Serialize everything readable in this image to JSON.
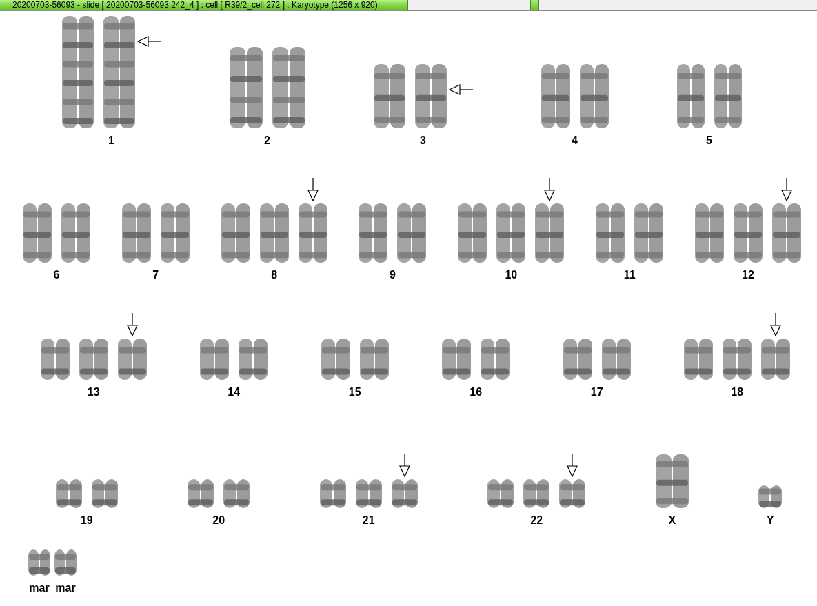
{
  "window": {
    "title": "20200703-56093 - slide [ 20200703-56093 242_4 ] : cell [ R39/2_cell 272 ] : Karyotype  (1256 x 920)"
  },
  "rows": [
    {
      "groups": [
        {
          "label": "1",
          "chromosomes": [
            {
              "marked": false
            },
            {
              "marked": true
            }
          ]
        },
        {
          "label": "2",
          "chromosomes": [
            {
              "marked": false
            },
            {
              "marked": false
            }
          ]
        },
        {
          "label": "3",
          "chromosomes": [
            {
              "marked": false
            },
            {
              "marked": true
            }
          ]
        },
        {
          "label": "4",
          "chromosomes": [
            {
              "marked": false
            },
            {
              "marked": false
            }
          ]
        },
        {
          "label": "5",
          "chromosomes": [
            {
              "marked": false
            },
            {
              "marked": false
            }
          ]
        }
      ]
    },
    {
      "groups": [
        {
          "label": "6",
          "chromosomes": [
            {
              "marked": false
            },
            {
              "marked": false
            }
          ]
        },
        {
          "label": "7",
          "chromosomes": [
            {
              "marked": false
            },
            {
              "marked": false
            }
          ]
        },
        {
          "label": "8",
          "chromosomes": [
            {
              "marked": false
            },
            {
              "marked": false
            },
            {
              "marked": true
            }
          ]
        },
        {
          "label": "9",
          "chromosomes": [
            {
              "marked": false
            },
            {
              "marked": false
            }
          ]
        },
        {
          "label": "10",
          "chromosomes": [
            {
              "marked": false
            },
            {
              "marked": false
            },
            {
              "marked": true
            }
          ]
        },
        {
          "label": "11",
          "chromosomes": [
            {
              "marked": false
            },
            {
              "marked": false
            }
          ]
        },
        {
          "label": "12",
          "chromosomes": [
            {
              "marked": false
            },
            {
              "marked": false
            },
            {
              "marked": true
            }
          ]
        }
      ]
    },
    {
      "groups": [
        {
          "label": "13",
          "chromosomes": [
            {
              "marked": false
            },
            {
              "marked": false
            },
            {
              "marked": true
            }
          ]
        },
        {
          "label": "14",
          "chromosomes": [
            {
              "marked": false
            },
            {
              "marked": false
            }
          ]
        },
        {
          "label": "15",
          "chromosomes": [
            {
              "marked": false
            },
            {
              "marked": false
            }
          ]
        },
        {
          "label": "16",
          "chromosomes": [
            {
              "marked": false
            },
            {
              "marked": false
            }
          ]
        },
        {
          "label": "17",
          "chromosomes": [
            {
              "marked": false
            },
            {
              "marked": false
            }
          ]
        },
        {
          "label": "18",
          "chromosomes": [
            {
              "marked": false
            },
            {
              "marked": false
            },
            {
              "marked": true
            }
          ]
        }
      ]
    },
    {
      "groups": [
        {
          "label": "19",
          "chromosomes": [
            {
              "marked": false
            },
            {
              "marked": false
            }
          ]
        },
        {
          "label": "20",
          "chromosomes": [
            {
              "marked": false
            },
            {
              "marked": false
            }
          ]
        },
        {
          "label": "21",
          "chromosomes": [
            {
              "marked": false
            },
            {
              "marked": false
            },
            {
              "marked": true
            }
          ]
        },
        {
          "label": "22",
          "chromosomes": [
            {
              "marked": false
            },
            {
              "marked": false
            },
            {
              "marked": true
            }
          ]
        },
        {
          "label": "X",
          "chromosomes": [
            {
              "marked": false
            }
          ]
        },
        {
          "label": "Y",
          "chromosomes": [
            {
              "marked": false
            }
          ]
        }
      ]
    },
    {
      "groups": [
        {
          "label": "mar",
          "chromosomes": [
            {
              "marked": false
            }
          ]
        },
        {
          "label": "mar",
          "chromosomes": [
            {
              "marked": false
            }
          ]
        }
      ]
    }
  ]
}
